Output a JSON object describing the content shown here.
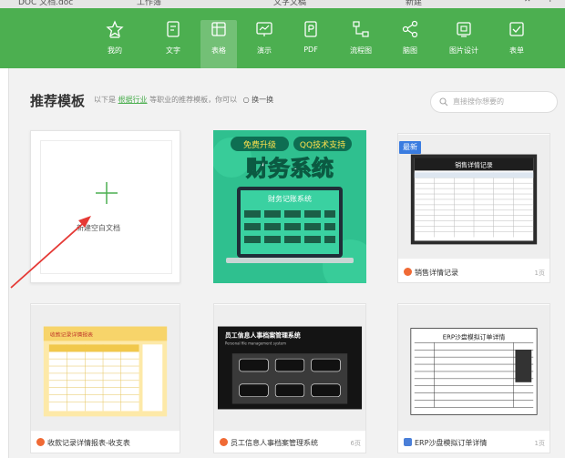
{
  "browser_tabs": [
    {
      "label": "DOC 文档.doc"
    },
    {
      "label": "工作簿"
    },
    {
      "label": "文字文稿"
    },
    {
      "label": "新建"
    }
  ],
  "toolbar": {
    "items": [
      {
        "label": "我的",
        "icon": "star-icon"
      },
      {
        "label": "文字",
        "icon": "document-icon"
      },
      {
        "label": "表格",
        "icon": "table-icon"
      },
      {
        "label": "演示",
        "icon": "presentation-icon"
      },
      {
        "label": "PDF",
        "icon": "pdf-icon"
      },
      {
        "label": "流程图",
        "icon": "flowchart-icon"
      },
      {
        "label": "脑图",
        "icon": "mindmap-icon"
      },
      {
        "label": "图片设计",
        "icon": "image-design-icon"
      },
      {
        "label": "表单",
        "icon": "form-icon"
      }
    ],
    "active": "表格"
  },
  "section": {
    "title": "推荐模板",
    "sub_prefix": "以下是",
    "sub_link": "根据行业",
    "sub_suffix": "等职业的推荐模板，你可以",
    "swap_label": "○ 换一换"
  },
  "search": {
    "placeholder": "直接搜你想要的"
  },
  "new_blank": {
    "label": "新建空白文档"
  },
  "badge": {
    "label": "最新"
  },
  "cards": [
    {
      "title": "财务系统",
      "banner1": "免费升级",
      "banner2": "QQ技术支持",
      "screen_title": "财务记账系统"
    },
    {
      "label": "销售详情记录",
      "pages": "1页",
      "sheet_title": "销售详情记录"
    },
    {
      "label": "收款记录详情报表-收支表",
      "pages": "",
      "sheet_title": "收款记录详情报表"
    },
    {
      "label": "员工信息人事档案管理系统",
      "pages": "6页",
      "sheet_title": "员工信息人事档案管理系统",
      "sheet_sub": "Personal file management system"
    },
    {
      "label": "ERP沙盘模拟订单详情",
      "pages": "1页",
      "sheet_title": "ERP沙盘模拟订单详情"
    }
  ],
  "colors": {
    "brand_green": "#4caf50",
    "orange": "#f06a35",
    "blue": "#3a7ce0"
  }
}
